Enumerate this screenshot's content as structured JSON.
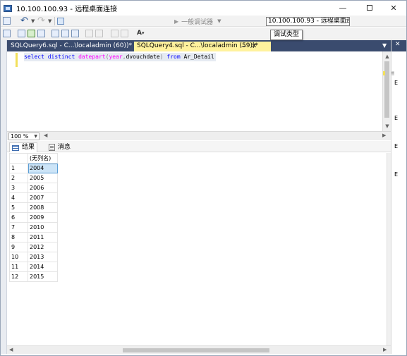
{
  "window": {
    "title": "10.100.100.93 - 远程桌面连接"
  },
  "toolbar": {
    "cmd_combo": "一般调试器",
    "address_input": "10.100.100.93 - 远程桌面连接",
    "tooltip": "调试类型",
    "font_button": "A"
  },
  "tabs": [
    {
      "label": "SQLQuery6.sql - C...\\localadmin (60))*",
      "active": false
    },
    {
      "label": "SQLQuery4.sql - C...\\localadmin (59))*",
      "active": true
    }
  ],
  "editor": {
    "keyword_select": "select",
    "keyword_distinct": "distinct",
    "function_datepart": "datepart",
    "paren_open": "(",
    "arg_year": "year",
    "comma": ",",
    "arg_column": "dvouchdate",
    "paren_close": ")",
    "keyword_from": "from",
    "table_name": "Ar_Detail"
  },
  "zoom": {
    "value": "100 %"
  },
  "results_tabs": {
    "results_label": "结果",
    "messages_label": "消息"
  },
  "grid": {
    "column_header": "(无列名)",
    "rows": [
      {
        "num": "1",
        "value": "2004"
      },
      {
        "num": "2",
        "value": "2005"
      },
      {
        "num": "3",
        "value": "2006"
      },
      {
        "num": "4",
        "value": "2007"
      },
      {
        "num": "5",
        "value": "2008"
      },
      {
        "num": "6",
        "value": "2009"
      },
      {
        "num": "7",
        "value": "2010"
      },
      {
        "num": "8",
        "value": "2011"
      },
      {
        "num": "9",
        "value": "2012"
      },
      {
        "num": "10",
        "value": "2013"
      },
      {
        "num": "11",
        "value": "2014"
      },
      {
        "num": "12",
        "value": "2015"
      }
    ]
  },
  "right_panel": {
    "letters": [
      "E",
      "E",
      "E",
      "E"
    ]
  },
  "colors": {
    "tab_bar": "#3a4b6e",
    "active_tab": "#fff29d",
    "selected_cell": "#cce4f7",
    "keyword": "#0000ff",
    "function": "#ff00ff"
  }
}
